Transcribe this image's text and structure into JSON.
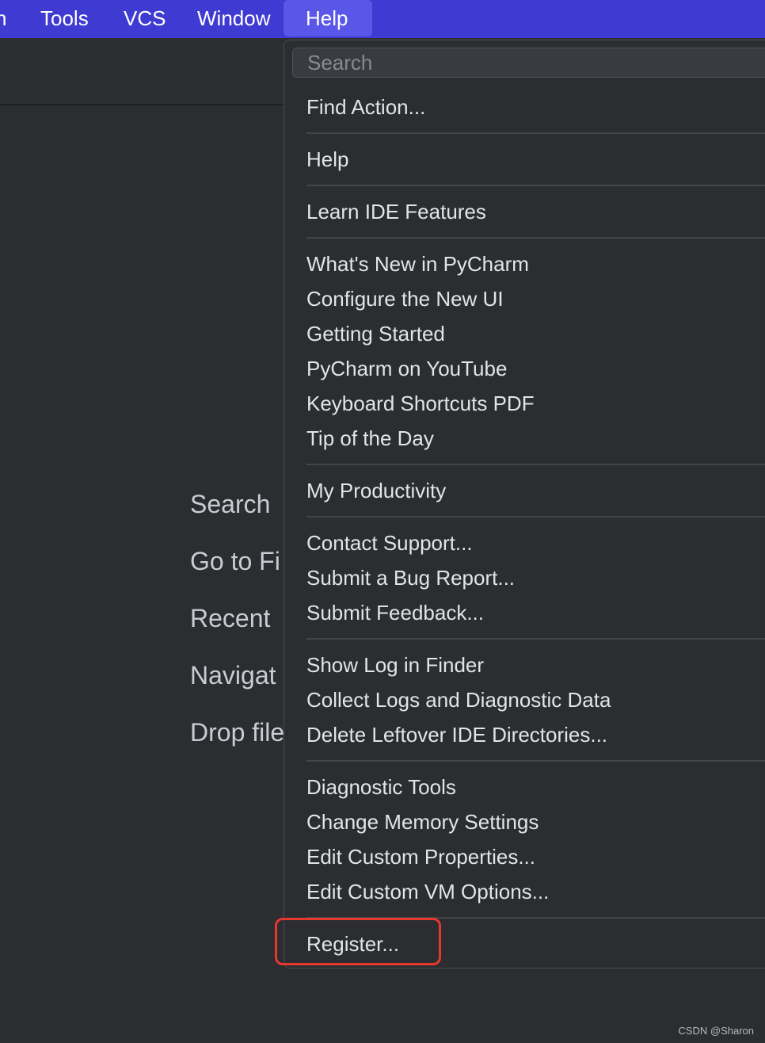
{
  "menubar": {
    "items": [
      {
        "label": "n"
      },
      {
        "label": "Tools"
      },
      {
        "label": "VCS"
      },
      {
        "label": "Window"
      },
      {
        "label": "Help"
      }
    ]
  },
  "welcome": {
    "items": [
      {
        "label": "Search"
      },
      {
        "label": "Go to Fi"
      },
      {
        "label": "Recent"
      },
      {
        "label": "Navigat"
      },
      {
        "label": "Drop file"
      }
    ]
  },
  "help_menu": {
    "search": {
      "placeholder": "Search",
      "value": ""
    },
    "items": [
      {
        "label": "Find Action..."
      },
      {
        "label": "Help"
      },
      {
        "label": "Learn IDE Features"
      },
      {
        "label": "What's New in PyCharm"
      },
      {
        "label": "Configure the New UI"
      },
      {
        "label": "Getting Started"
      },
      {
        "label": "PyCharm on YouTube"
      },
      {
        "label": "Keyboard Shortcuts PDF"
      },
      {
        "label": "Tip of the Day"
      },
      {
        "label": "My Productivity"
      },
      {
        "label": "Contact Support..."
      },
      {
        "label": "Submit a Bug Report..."
      },
      {
        "label": "Submit Feedback..."
      },
      {
        "label": "Show Log in Finder"
      },
      {
        "label": "Collect Logs and Diagnostic Data"
      },
      {
        "label": "Delete Leftover IDE Directories..."
      },
      {
        "label": "Diagnostic Tools"
      },
      {
        "label": "Change Memory Settings"
      },
      {
        "label": "Edit Custom Properties..."
      },
      {
        "label": "Edit Custom VM Options..."
      },
      {
        "label": "Register..."
      }
    ]
  },
  "watermark": {
    "text": "CSDN @Sharon\u0001"
  },
  "colors": {
    "menubar_bg": "#3f3bd2",
    "menubar_active": "#5a57e8",
    "popup_bg": "#2b2d30",
    "highlight": "#e8372f"
  }
}
